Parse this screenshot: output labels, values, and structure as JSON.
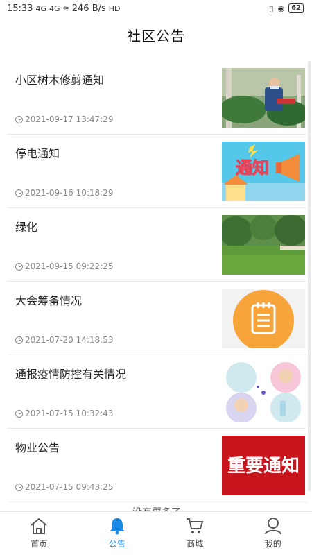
{
  "status": {
    "time": "15:33",
    "signal1": "4G",
    "signal2": "4G",
    "speed": "246 B/s",
    "hd": "HD",
    "battery": "62"
  },
  "header": {
    "title": "社区公告"
  },
  "notices": [
    {
      "title": "小区树木修剪通知",
      "time": "2021-09-17 13:47:29",
      "thumb": "tree-trimming-photo"
    },
    {
      "title": "停电通知",
      "time": "2021-09-16 10:18:29",
      "thumb": "notice-megaphone-image"
    },
    {
      "title": "绿化",
      "time": "2021-09-15 09:22:25",
      "thumb": "park-lawn-photo"
    },
    {
      "title": "大会筹备情况",
      "time": "2021-07-20 14:18:53",
      "thumb": "orange-notepad-icon"
    },
    {
      "title": "通报疫情防控有关情况",
      "time": "2021-07-15 10:32:43",
      "thumb": "handwashing-kids-image"
    },
    {
      "title": "物业公告",
      "time": "2021-07-15 09:43:25",
      "thumb": "important-notice-banner"
    }
  ],
  "important_banner_text": "重要通知",
  "notice_badge_text": "通知",
  "footer_text": "没有更多了",
  "tabs": [
    {
      "label": "首页",
      "icon": "home-icon",
      "active": false
    },
    {
      "label": "公告",
      "icon": "bell-icon",
      "active": true
    },
    {
      "label": "商城",
      "icon": "cart-icon",
      "active": false
    },
    {
      "label": "我的",
      "icon": "user-icon",
      "active": false
    }
  ],
  "colors": {
    "accent": "#1a8ae6",
    "banner_red": "#c8141c",
    "orange": "#f7a43a"
  }
}
